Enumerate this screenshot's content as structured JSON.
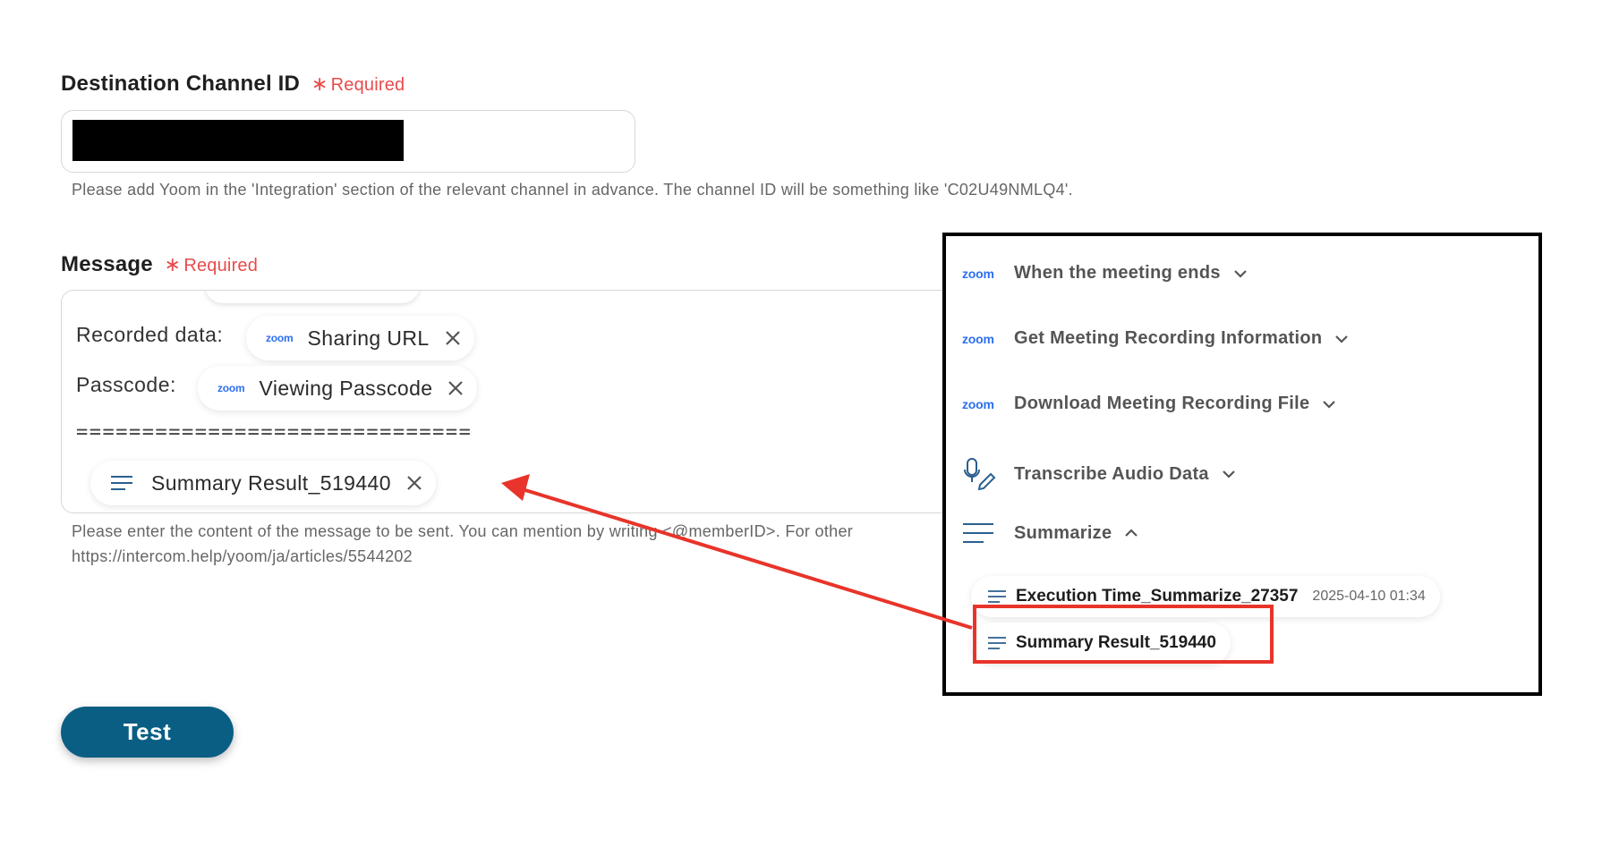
{
  "channel_field": {
    "label": "Destination Channel ID",
    "required_star": "∗",
    "required_text": "Required",
    "help": "Please add Yoom in the 'Integration' section of the relevant channel in advance. The channel ID will be something like 'C02U49NMLQ4'."
  },
  "message_field": {
    "label": "Message",
    "required_star": "∗",
    "required_text": "Required",
    "rows": {
      "recorded_label": "Recorded data:",
      "recorded_chip_brand": "zoom",
      "recorded_chip": "Sharing URL",
      "passcode_label": "Passcode:",
      "passcode_chip_brand": "zoom",
      "passcode_chip": "Viewing Passcode",
      "separator": "==============================",
      "summary_chip": "Summary Result_519440"
    },
    "help_line1": "Please enter the content of the message to be sent. You can mention by writing <@memberID>. For other",
    "help_line2": "https://intercom.help/yoom/ja/articles/5544202"
  },
  "test_button": "Test",
  "panel": {
    "steps": [
      {
        "brand": "zoom",
        "label": "When the meeting ends"
      },
      {
        "brand": "zoom",
        "label": "Get Meeting Recording Information"
      },
      {
        "brand": "zoom",
        "label": "Download Meeting Recording File"
      },
      {
        "label": "Transcribe Audio Data"
      },
      {
        "label": "Summarize"
      }
    ],
    "outputs": [
      {
        "label": "Execution Time_Summarize_27357",
        "timestamp": "2025-04-10 01:34"
      },
      {
        "label": "Summary Result_519440"
      }
    ]
  },
  "colors": {
    "required": "#e84b4b",
    "button": "#0a5e84",
    "zoom_brand": "#2d6ff0",
    "annotation_red": "#e8342a"
  },
  "icons": [
    "close-icon",
    "lines-icon",
    "chevron-down-icon",
    "chevron-up-icon",
    "microphone-pen-icon"
  ]
}
